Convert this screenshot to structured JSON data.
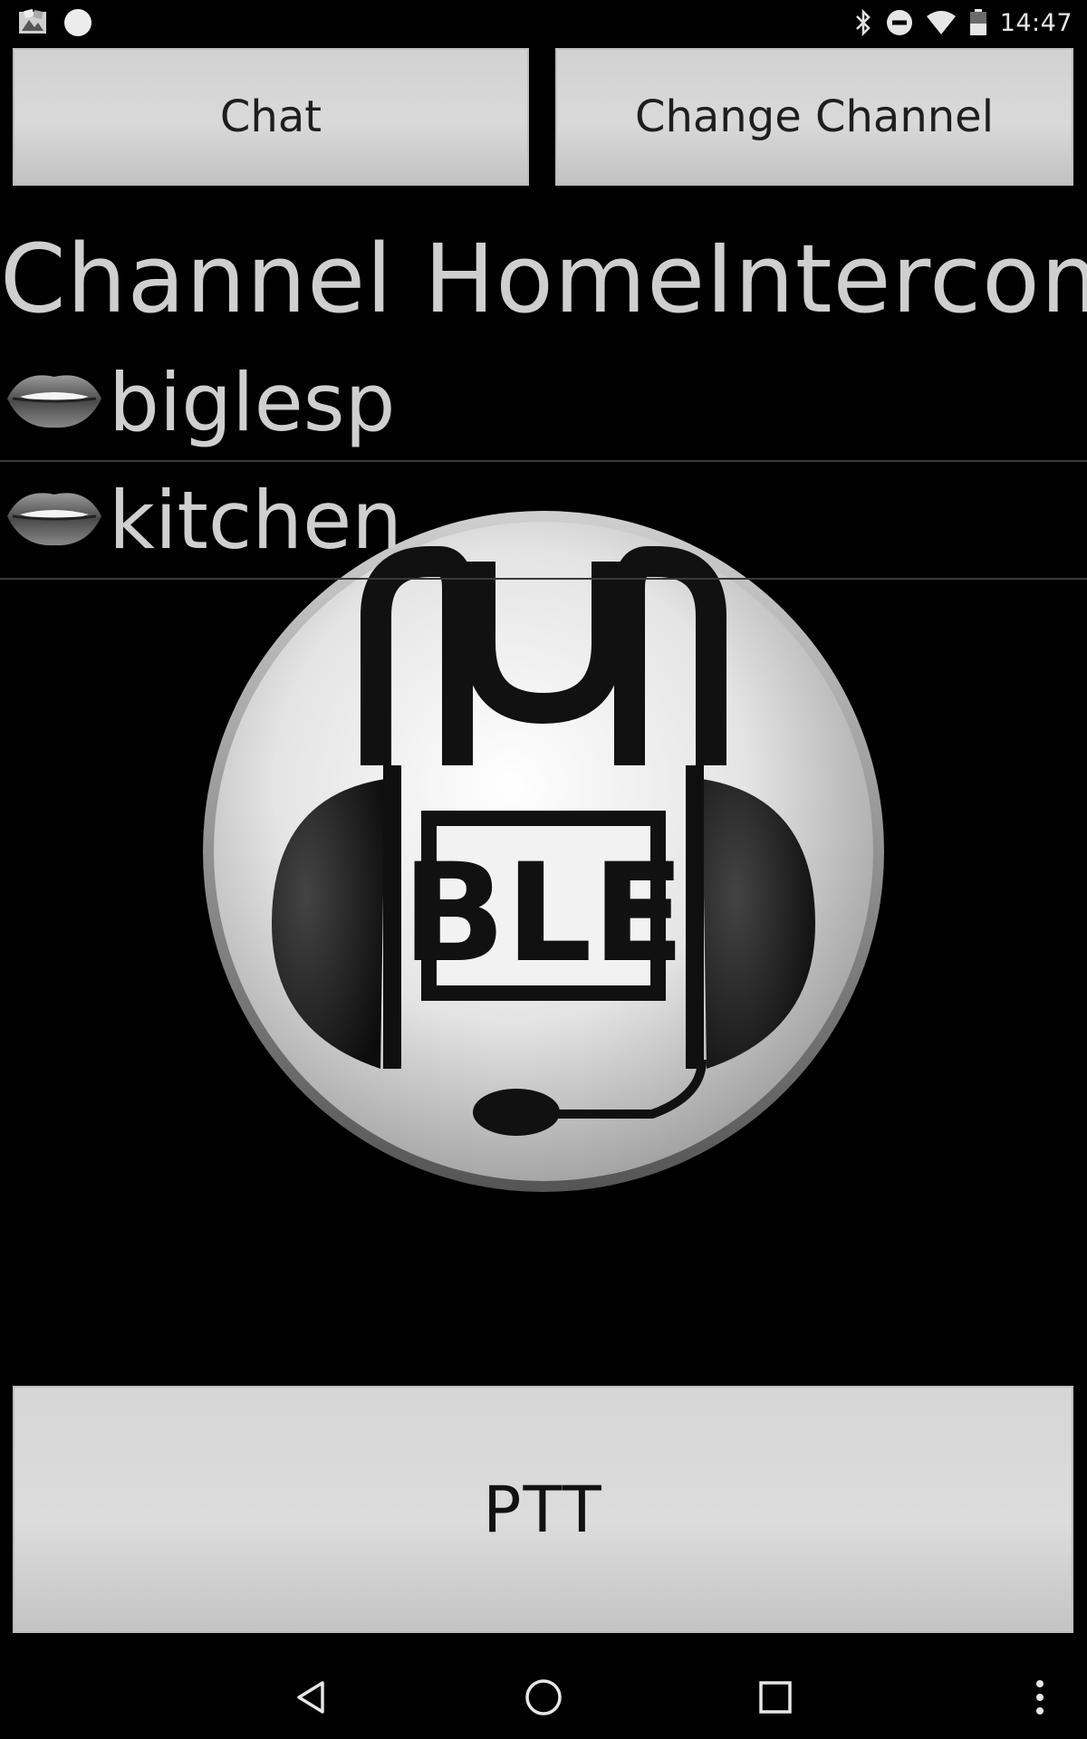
{
  "status_bar": {
    "time": "14:47",
    "left_icons": [
      "gallery-notification-icon",
      "circle-notification-icon"
    ],
    "right_icons": [
      "bluetooth-icon",
      "do-not-disturb-icon",
      "wifi-icon",
      "battery-icon"
    ]
  },
  "toolbar": {
    "chat_label": "Chat",
    "change_channel_label": "Change Channel"
  },
  "channel": {
    "title": "Channel HomeIntercom"
  },
  "users": [
    {
      "name": "biglesp",
      "icon": "lips-icon"
    },
    {
      "name": "kitchen",
      "icon": "lips-icon"
    }
  ],
  "logo": {
    "text": "BLE",
    "icon": "headset-logo-icon"
  },
  "ptt": {
    "label": "PTT"
  },
  "nav_bar": {
    "icons": [
      "back-icon",
      "home-icon",
      "recents-icon",
      "overflow-menu-icon"
    ]
  },
  "colors": {
    "background": "#000000",
    "button": "#d6d6d6",
    "text_light": "#cfcfcf"
  }
}
